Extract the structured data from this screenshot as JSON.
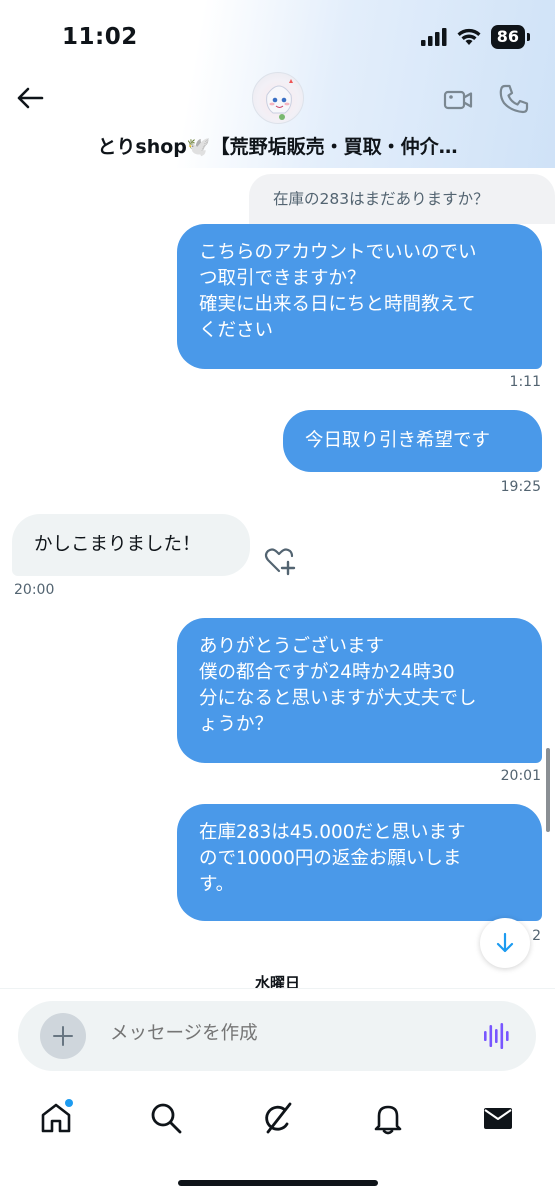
{
  "status_bar": {
    "time": "11:02",
    "battery": "86"
  },
  "header": {
    "title": "とりshop🕊️【荒野垢販売・買取・仲介…"
  },
  "messages": {
    "quoted": "在庫の283はまだありますか？",
    "m1": [
      "こちらのアカウントでいいのでい",
      "つ取引できますか？",
      "確実に出来る日にちと時間教えて",
      "ください"
    ],
    "m1_time": "1:11",
    "m2": "今日取り引き希望です",
    "m2_time": "19:25",
    "m3": "かしこまりました！",
    "m3_time": "20:00",
    "m4": [
      "ありがとうございます",
      "僕の都合ですが24時か24時30",
      "分になると思いますが大丈夫でし",
      "ょうか？"
    ],
    "m4_time": "20:01",
    "m5": [
      "在庫283は45.000だと思います",
      "ので10000円の返金お願いしま",
      "す。"
    ],
    "m5_time": "2",
    "day_label": "水曜日"
  },
  "composer": {
    "placeholder": "メッセージを作成"
  },
  "icons": {
    "back": "arrow-left-icon",
    "video": "video-camera-icon",
    "phone": "phone-icon",
    "react": "heart-plus-icon",
    "scroll_down": "arrow-down-icon",
    "add": "plus-icon",
    "voice": "voice-wave-icon",
    "nav": [
      "home-icon",
      "search-icon",
      "grok-icon",
      "bell-icon",
      "mail-icon"
    ]
  },
  "colors": {
    "outgoing_bubble": "#4a99e9",
    "incoming_bubble": "#eff3f4",
    "accent": "#1d9bf0",
    "voice": "#7856ff"
  }
}
